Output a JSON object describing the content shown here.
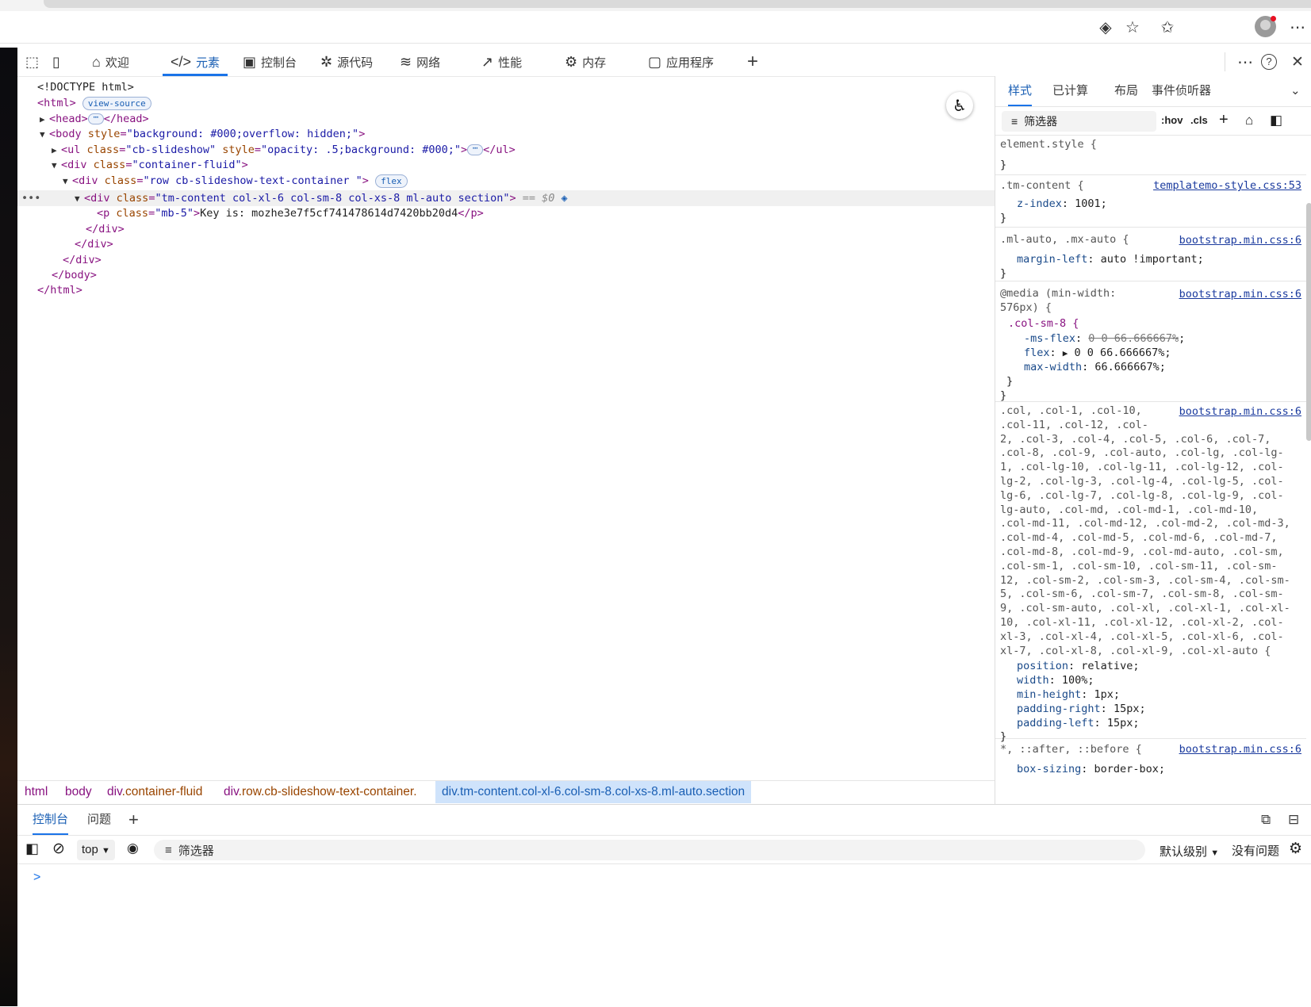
{
  "dom_tree": {
    "doctype": "<!DOCTYPE html>",
    "html_open": "<html>",
    "view_source_badge": "view-source",
    "head_open": "<head>",
    "head_close": "</head>",
    "body_tag": "body",
    "body_attr": "style",
    "body_val": "\"background: #000;overflow: hidden;\"",
    "ul_tag": "ul",
    "ul_attr1": "class",
    "ul_val1": "\"cb-slideshow\"",
    "ul_attr2": "style",
    "ul_val2": "\"opacity: .5;background: #000;\"",
    "ul_close": "</ul>",
    "div1_tag": "div",
    "div1_attr": "class",
    "div1_val": "\"container-fluid\"",
    "div2_tag": "div",
    "div2_attr": "class",
    "div2_val": "\"row cb-slideshow-text-container \"",
    "flex_badge": "flex",
    "div3_tag": "div",
    "div3_attr": "class",
    "div3_val": "\"tm-content col-xl-6 col-sm-8 col-xs-8 ml-auto section\"",
    "selected_marker": "== $0",
    "p_tag": "p",
    "p_attr": "class",
    "p_val": "\"mb-5\"",
    "p_text": "Key is: mozhe3e7f5cf741478614d7420bb20d4",
    "p_close": "</p>",
    "div_close": "</div>",
    "body_close": "</body>",
    "html_close": "</html>",
    "row_more": "•••"
  },
  "devtools_tabs": [
    {
      "label": "欢迎",
      "icon": "⌂"
    },
    {
      "label": "元素",
      "icon": "</>"
    },
    {
      "label": "控制台",
      "icon": "▣"
    },
    {
      "label": "源代码",
      "icon": "✲"
    },
    {
      "label": "网络",
      "icon": "≋"
    },
    {
      "label": "性能",
      "icon": "↗"
    },
    {
      "label": "内存",
      "icon": "⚙"
    },
    {
      "label": "应用程序",
      "icon": "▢"
    }
  ],
  "toolbar_icons": {
    "add": "+",
    "more": "⋯",
    "help": "?",
    "close": "✕",
    "inspect": "⬚",
    "device": "▯"
  },
  "breadcrumbs": {
    "html": "html",
    "body": "body",
    "div1_tag": "div",
    "div1_cls": ".container-fluid",
    "div2_tag": "div",
    "div2_cls": ".row.cb-slideshow-text-container.",
    "div3": "div.tm-content.col-xl-6.col-sm-8.col-xs-8.ml-auto.section"
  },
  "styles_pane": {
    "tabs": [
      "样式",
      "已计算",
      "布局",
      "事件侦听器"
    ],
    "filter_label": "筛选器",
    "hov": ":hov",
    "cls": ".cls",
    "element_style": "element.style {",
    "close_brace": "}",
    "rule1": {
      "selector": ".tm-content {",
      "source": "templatemo-style.css:53",
      "prop": "z-index",
      "value": "1001;"
    },
    "rule2": {
      "selector": ".ml-auto, .mx-auto {",
      "source": "bootstrap.min.css:6",
      "prop": "margin-left",
      "value": "auto !important;"
    },
    "rule3": {
      "media1": "@media (min-width:",
      "media2": "576px) {",
      "selector": ".col-sm-8 {",
      "source": "bootstrap.min.css:6",
      "p1": "-ms-flex",
      "v1": "0 0 66.666667%",
      "p2": "flex",
      "v2": "0 0 66.666667%;",
      "p3": "max-width",
      "v3": "66.666667%;",
      "inner_close": "}"
    },
    "rule4": {
      "source": "bootstrap.min.css:6",
      "lines": [
        ".col, .col-1, .col-10,",
        ".col-11, .col-12, .col-",
        "2, .col-3, .col-4, .col-5, .col-6, .col-7,",
        ".col-8, .col-9, .col-auto, .col-lg, .col-lg-",
        "1, .col-lg-10, .col-lg-11, .col-lg-12, .col-",
        "lg-2, .col-lg-3, .col-lg-4, .col-lg-5, .col-",
        "lg-6, .col-lg-7, .col-lg-8, .col-lg-9, .col-",
        "lg-auto, .col-md, .col-md-1, .col-md-10,",
        ".col-md-11, .col-md-12, .col-md-2, .col-md-3,",
        ".col-md-4, .col-md-5, .col-md-6, .col-md-7,",
        ".col-md-8, .col-md-9, .col-md-auto, .col-sm,",
        ".col-sm-1, .col-sm-10, .col-sm-11, .col-sm-",
        "12, .col-sm-2, .col-sm-3, .col-sm-4, .col-sm-",
        "5, .col-sm-6, .col-sm-7, .col-sm-8, .col-sm-",
        "9, .col-sm-auto, .col-xl, .col-xl-1, .col-xl-",
        "10, .col-xl-11, .col-xl-12, .col-xl-2, .col-",
        "xl-3, .col-xl-4, .col-xl-5, .col-xl-6, .col-",
        "xl-7, .col-xl-8, .col-xl-9, .col-xl-auto {"
      ],
      "props": [
        {
          "p": "position",
          "v": "relative;"
        },
        {
          "p": "width",
          "v": "100%;"
        },
        {
          "p": "min-height",
          "v": "1px;"
        },
        {
          "p": "padding-right",
          "v": "15px;"
        },
        {
          "p": "padding-left",
          "v": "15px;"
        }
      ]
    },
    "rule5": {
      "selector": "*, ::after, ::before {",
      "source": "bootstrap.min.css:6",
      "prop": "box-sizing",
      "value": "border-box;"
    }
  },
  "drawer": {
    "tab_console": "控制台",
    "tab_issues": "问题",
    "context": "top",
    "filter": "筛选器",
    "level": "默认级别",
    "no_issues": "没有问题",
    "prompt": ">"
  }
}
